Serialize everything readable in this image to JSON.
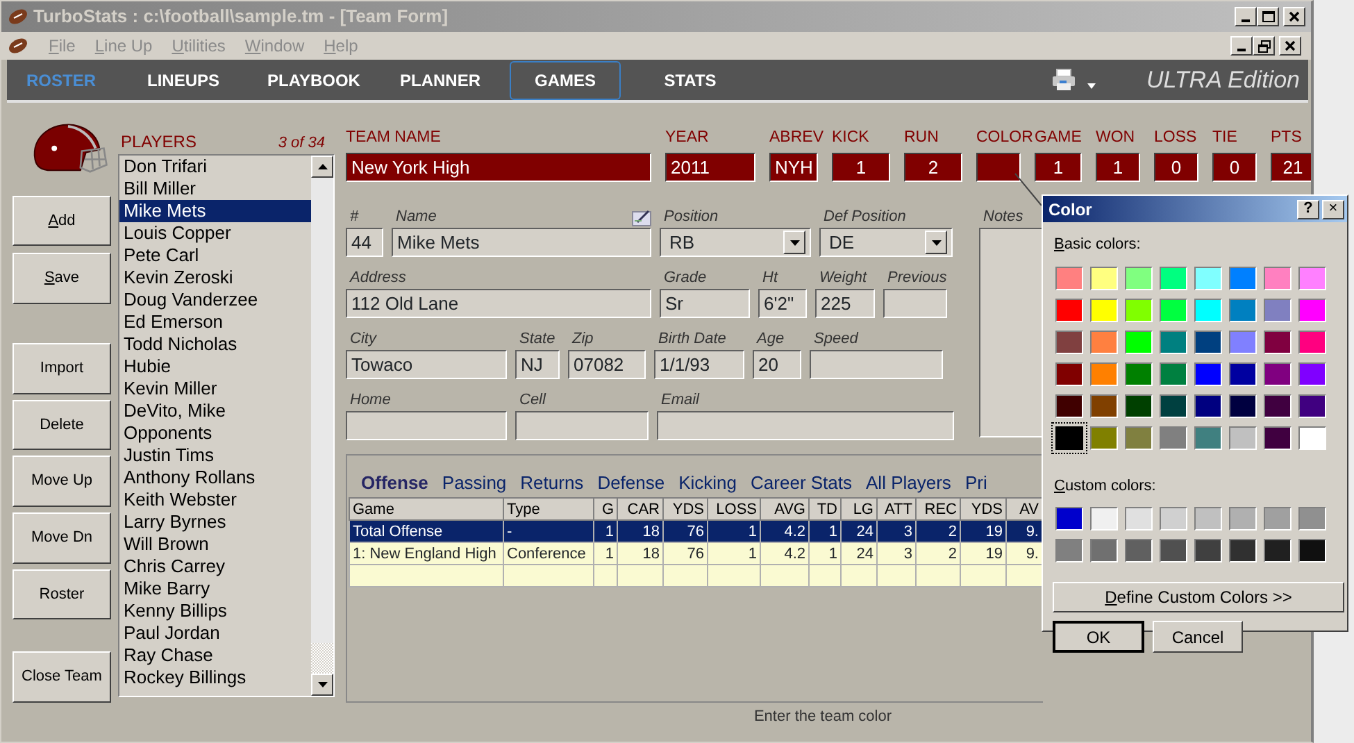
{
  "window": {
    "title": "TurboStats : c:\\football\\sample.tm - [Team Form]"
  },
  "menu": [
    "File",
    "Line Up",
    "Utilities",
    "Window",
    "Help"
  ],
  "nav": [
    {
      "label": "ROSTER",
      "selected": true,
      "focused": false
    },
    {
      "label": "LINEUPS",
      "selected": false,
      "focused": false
    },
    {
      "label": "PLAYBOOK",
      "selected": false,
      "focused": false
    },
    {
      "label": "PLANNER",
      "selected": false,
      "focused": false
    },
    {
      "label": "GAMES",
      "selected": false,
      "focused": true
    },
    {
      "label": "STATS",
      "selected": false,
      "focused": false
    }
  ],
  "edition": "ULTRA Edition",
  "side_buttons": [
    "Add",
    "Save",
    "Import",
    "Delete",
    "Move Up",
    "Move Dn",
    "Roster",
    "Close Team"
  ],
  "players": {
    "label": "PLAYERS",
    "count": "3 of 34",
    "items": [
      {
        "name": "Don Trifari",
        "selected": false
      },
      {
        "name": "Bill Miller",
        "selected": false
      },
      {
        "name": "Mike Mets",
        "selected": true
      },
      {
        "name": "Louis Copper",
        "selected": false
      },
      {
        "name": "Pete Carl",
        "selected": false
      },
      {
        "name": "Kevin Zeroski",
        "selected": false
      },
      {
        "name": "Doug Vanderzee",
        "selected": false
      },
      {
        "name": "Ed Emerson",
        "selected": false
      },
      {
        "name": "Todd Nicholas",
        "selected": false
      },
      {
        "name": "Hubie",
        "selected": false
      },
      {
        "name": "Kevin Miller",
        "selected": false
      },
      {
        "name": "DeVito, Mike",
        "selected": false
      },
      {
        "name": "Opponents",
        "selected": false
      },
      {
        "name": "Justin Tims",
        "selected": false
      },
      {
        "name": "Anthony Rollans",
        "selected": false
      },
      {
        "name": "Keith Webster",
        "selected": false
      },
      {
        "name": "Larry Byrnes",
        "selected": false
      },
      {
        "name": "Will Brown",
        "selected": false
      },
      {
        "name": "Chris Carrey",
        "selected": false
      },
      {
        "name": "Mike Barry",
        "selected": false
      },
      {
        "name": "Kenny Billips",
        "selected": false
      },
      {
        "name": "Paul Jordan",
        "selected": false
      },
      {
        "name": "Ray Chase",
        "selected": false
      },
      {
        "name": "Rockey Billings",
        "selected": false
      }
    ]
  },
  "team": [
    {
      "label": "TEAM NAME",
      "value": "New York High"
    },
    {
      "label": "YEAR",
      "value": "2011"
    },
    {
      "label": "ABREV",
      "value": "NYH"
    },
    {
      "label": "KICK",
      "value": "1"
    },
    {
      "label": "RUN",
      "value": "2"
    },
    {
      "label": "COLOR"
    },
    {
      "label": "GAME",
      "value": "1"
    },
    {
      "label": "WON",
      "value": "1"
    },
    {
      "label": "LOSS",
      "value": "0"
    },
    {
      "label": "TIE",
      "value": "0"
    },
    {
      "label": "PTS",
      "value": "21"
    }
  ],
  "player_form": {
    "fields": [
      {
        "label": "#",
        "value": "44",
        "kind": "text"
      },
      {
        "label": "Name",
        "value": "Mike Mets",
        "kind": "text",
        "edit_icon": true
      },
      {
        "label": "Position",
        "value": "RB",
        "kind": "select"
      },
      {
        "label": "Def Position",
        "value": "DE",
        "kind": "select"
      },
      {
        "label": "Address",
        "value": "112 Old Lane",
        "kind": "text"
      },
      {
        "label": "Grade",
        "value": "Sr",
        "kind": "text"
      },
      {
        "label": "Ht",
        "value": "6'2\"",
        "kind": "text"
      },
      {
        "label": "Weight",
        "value": "225",
        "kind": "text"
      },
      {
        "label": "Previous",
        "kind": "text"
      },
      {
        "label": "City",
        "value": "Towaco",
        "kind": "text"
      },
      {
        "label": "State",
        "value": "NJ",
        "kind": "text"
      },
      {
        "label": "Zip",
        "value": "07082",
        "kind": "text"
      },
      {
        "label": "Birth Date",
        "value": "1/1/93",
        "kind": "text"
      },
      {
        "label": "Age",
        "value": "20",
        "kind": "text"
      },
      {
        "label": "Speed",
        "kind": "text"
      },
      {
        "label": "Home",
        "kind": "text"
      },
      {
        "label": "Cell",
        "kind": "text"
      },
      {
        "label": "Email",
        "kind": "text"
      }
    ],
    "notes": {
      "label": "Notes"
    }
  },
  "stats": {
    "tabs": [
      {
        "label": "Offense",
        "selected": true
      },
      {
        "label": "Passing",
        "selected": false
      },
      {
        "label": "Returns",
        "selected": false
      },
      {
        "label": "Defense",
        "selected": false
      },
      {
        "label": "Kicking",
        "selected": false
      },
      {
        "label": "Career Stats",
        "selected": false
      },
      {
        "label": "All Players",
        "selected": false
      },
      {
        "label": "Pri",
        "selected": false
      }
    ],
    "columns": [
      "Game",
      "Type",
      "G",
      "CAR",
      "YDS",
      "LOSS",
      "AVG",
      "TD",
      "LG",
      "ATT",
      "REC",
      "YDS",
      "AV"
    ],
    "rows": [
      {
        "cells": [
          "Total Offense",
          "-",
          "1",
          "18",
          "76",
          "1",
          "4.2",
          "1",
          "24",
          "3",
          "2",
          "19",
          "9."
        ],
        "selected": true
      },
      {
        "cells": [
          "1: New England High",
          "Conference",
          "1",
          "18",
          "76",
          "1",
          "4.2",
          "1",
          "24",
          "3",
          "2",
          "19",
          "9."
        ],
        "selected": false
      }
    ]
  },
  "status_bar": "Enter the team color",
  "color_dialog": {
    "title": "Color",
    "help": "?",
    "close": "×",
    "basic_label": "Basic colors:",
    "basic_colors": [
      {
        "color": "#ff8080",
        "selected": false
      },
      {
        "color": "#ffff80",
        "selected": false
      },
      {
        "color": "#80ff80",
        "selected": false
      },
      {
        "color": "#00ff80",
        "selected": false
      },
      {
        "color": "#80ffff",
        "selected": false
      },
      {
        "color": "#0080ff",
        "selected": false
      },
      {
        "color": "#ff80c0",
        "selected": false
      },
      {
        "color": "#ff80ff",
        "selected": false
      },
      {
        "color": "#ff0000",
        "selected": false
      },
      {
        "color": "#ffff00",
        "selected": false
      },
      {
        "color": "#80ff00",
        "selected": false
      },
      {
        "color": "#00ff40",
        "selected": false
      },
      {
        "color": "#00ffff",
        "selected": false
      },
      {
        "color": "#0080c0",
        "selected": false
      },
      {
        "color": "#8080c0",
        "selected": false
      },
      {
        "color": "#ff00ff",
        "selected": false
      },
      {
        "color": "#804040",
        "selected": false
      },
      {
        "color": "#ff8040",
        "selected": false
      },
      {
        "color": "#00ff00",
        "selected": false
      },
      {
        "color": "#008080",
        "selected": false
      },
      {
        "color": "#004080",
        "selected": false
      },
      {
        "color": "#8080ff",
        "selected": false
      },
      {
        "color": "#800040",
        "selected": false
      },
      {
        "color": "#ff0080",
        "selected": false
      },
      {
        "color": "#800000",
        "selected": false
      },
      {
        "color": "#ff8000",
        "selected": false
      },
      {
        "color": "#008000",
        "selected": false
      },
      {
        "color": "#008040",
        "selected": false
      },
      {
        "color": "#0000ff",
        "selected": false
      },
      {
        "color": "#0000a0",
        "selected": false
      },
      {
        "color": "#800080",
        "selected": false
      },
      {
        "color": "#8000ff",
        "selected": false
      },
      {
        "color": "#400000",
        "selected": false
      },
      {
        "color": "#804000",
        "selected": false
      },
      {
        "color": "#004000",
        "selected": false
      },
      {
        "color": "#004040",
        "selected": false
      },
      {
        "color": "#000080",
        "selected": false
      },
      {
        "color": "#000040",
        "selected": false
      },
      {
        "color": "#400040",
        "selected": false
      },
      {
        "color": "#400080",
        "selected": false
      },
      {
        "color": "#000000",
        "selected": true
      },
      {
        "color": "#808000",
        "selected": false
      },
      {
        "color": "#808040",
        "selected": false
      },
      {
        "color": "#808080",
        "selected": false
      },
      {
        "color": "#408080",
        "selected": false
      },
      {
        "color": "#c0c0c0",
        "selected": false
      },
      {
        "color": "#400040",
        "selected": false
      },
      {
        "color": "#ffffff",
        "selected": false
      }
    ],
    "custom_label": "Custom colors:",
    "custom_colors": [
      {
        "color": "#0000cc"
      },
      {
        "color": "#f0f0f0"
      },
      {
        "color": "#e0e0e0"
      },
      {
        "color": "#d0d0d0"
      },
      {
        "color": "#c0c0c0"
      },
      {
        "color": "#b0b0b0"
      },
      {
        "color": "#a0a0a0"
      },
      {
        "color": "#909090"
      },
      {
        "color": "#808080"
      },
      {
        "color": "#707070"
      },
      {
        "color": "#606060"
      },
      {
        "color": "#505050"
      },
      {
        "color": "#404040"
      },
      {
        "color": "#303030"
      },
      {
        "color": "#202020"
      },
      {
        "color": "#101010"
      }
    ],
    "define_button": "Define Custom Colors >>",
    "ok": "OK",
    "cancel": "Cancel"
  }
}
